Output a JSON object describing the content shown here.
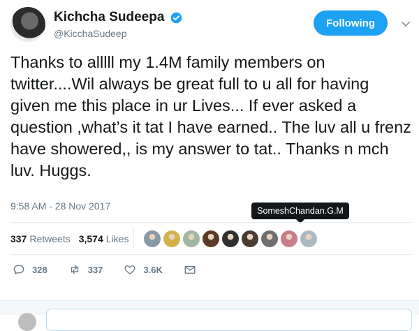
{
  "header": {
    "display_name": "Kichcha Sudeepa",
    "handle": "@KicchaSudeep",
    "follow_label": "Following"
  },
  "tweet": {
    "text": "Thanks to alllll my 1.4M family members on twitter....Wil always be great full to u all for having given me this place in ur Lives... If ever asked a question ,what’s it tat I have earned.. The luv all u frenz have showered,, is my answer to tat.. Thanks n mch luv. Huggs.",
    "timestamp": "9:58 AM - 28 Nov 2017"
  },
  "tooltip": {
    "text": "SomeshChandan.G.M"
  },
  "stats": {
    "retweets_count": "337",
    "retweets_label": "Retweets",
    "likes_count": "3,574",
    "likes_label": "Likes"
  },
  "liker_avatars": [
    {
      "color": "#8899a6"
    },
    {
      "color": "#d4b24a"
    },
    {
      "color": "#9fb7a0"
    },
    {
      "color": "#5b3a2a"
    },
    {
      "color": "#2f2f2f"
    },
    {
      "color": "#4a3b30"
    },
    {
      "color": "#6f6f6f"
    },
    {
      "color": "#c97d8a"
    },
    {
      "color": "#aab8c2"
    }
  ],
  "actions": {
    "reply_count": "328",
    "retweet_count": "337",
    "like_count": "3.6K"
  },
  "colors": {
    "accent": "#1da1f2",
    "text_primary": "#14171a",
    "text_secondary": "#657786"
  },
  "icons": [
    "verified-badge-icon",
    "chevron-down-icon",
    "reply-icon",
    "retweet-icon",
    "like-icon",
    "direct-message-icon"
  ]
}
